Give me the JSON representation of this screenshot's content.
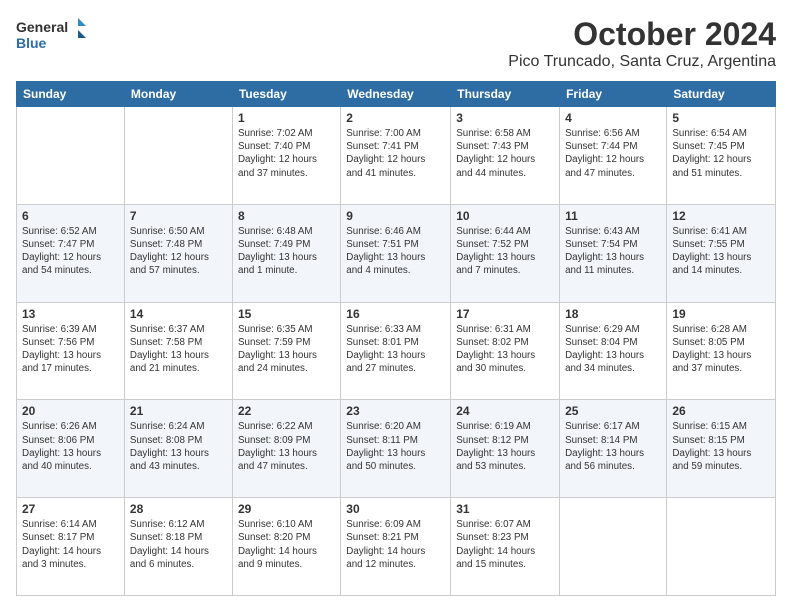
{
  "header": {
    "logo_line1": "General",
    "logo_line2": "Blue",
    "title": "October 2024",
    "subtitle": "Pico Truncado, Santa Cruz, Argentina"
  },
  "days_of_week": [
    "Sunday",
    "Monday",
    "Tuesday",
    "Wednesday",
    "Thursday",
    "Friday",
    "Saturday"
  ],
  "weeks": [
    [
      {
        "day": "",
        "info": ""
      },
      {
        "day": "",
        "info": ""
      },
      {
        "day": "1",
        "info": "Sunrise: 7:02 AM\nSunset: 7:40 PM\nDaylight: 12 hours\nand 37 minutes."
      },
      {
        "day": "2",
        "info": "Sunrise: 7:00 AM\nSunset: 7:41 PM\nDaylight: 12 hours\nand 41 minutes."
      },
      {
        "day": "3",
        "info": "Sunrise: 6:58 AM\nSunset: 7:43 PM\nDaylight: 12 hours\nand 44 minutes."
      },
      {
        "day": "4",
        "info": "Sunrise: 6:56 AM\nSunset: 7:44 PM\nDaylight: 12 hours\nand 47 minutes."
      },
      {
        "day": "5",
        "info": "Sunrise: 6:54 AM\nSunset: 7:45 PM\nDaylight: 12 hours\nand 51 minutes."
      }
    ],
    [
      {
        "day": "6",
        "info": "Sunrise: 6:52 AM\nSunset: 7:47 PM\nDaylight: 12 hours\nand 54 minutes."
      },
      {
        "day": "7",
        "info": "Sunrise: 6:50 AM\nSunset: 7:48 PM\nDaylight: 12 hours\nand 57 minutes."
      },
      {
        "day": "8",
        "info": "Sunrise: 6:48 AM\nSunset: 7:49 PM\nDaylight: 13 hours\nand 1 minute."
      },
      {
        "day": "9",
        "info": "Sunrise: 6:46 AM\nSunset: 7:51 PM\nDaylight: 13 hours\nand 4 minutes."
      },
      {
        "day": "10",
        "info": "Sunrise: 6:44 AM\nSunset: 7:52 PM\nDaylight: 13 hours\nand 7 minutes."
      },
      {
        "day": "11",
        "info": "Sunrise: 6:43 AM\nSunset: 7:54 PM\nDaylight: 13 hours\nand 11 minutes."
      },
      {
        "day": "12",
        "info": "Sunrise: 6:41 AM\nSunset: 7:55 PM\nDaylight: 13 hours\nand 14 minutes."
      }
    ],
    [
      {
        "day": "13",
        "info": "Sunrise: 6:39 AM\nSunset: 7:56 PM\nDaylight: 13 hours\nand 17 minutes."
      },
      {
        "day": "14",
        "info": "Sunrise: 6:37 AM\nSunset: 7:58 PM\nDaylight: 13 hours\nand 21 minutes."
      },
      {
        "day": "15",
        "info": "Sunrise: 6:35 AM\nSunset: 7:59 PM\nDaylight: 13 hours\nand 24 minutes."
      },
      {
        "day": "16",
        "info": "Sunrise: 6:33 AM\nSunset: 8:01 PM\nDaylight: 13 hours\nand 27 minutes."
      },
      {
        "day": "17",
        "info": "Sunrise: 6:31 AM\nSunset: 8:02 PM\nDaylight: 13 hours\nand 30 minutes."
      },
      {
        "day": "18",
        "info": "Sunrise: 6:29 AM\nSunset: 8:04 PM\nDaylight: 13 hours\nand 34 minutes."
      },
      {
        "day": "19",
        "info": "Sunrise: 6:28 AM\nSunset: 8:05 PM\nDaylight: 13 hours\nand 37 minutes."
      }
    ],
    [
      {
        "day": "20",
        "info": "Sunrise: 6:26 AM\nSunset: 8:06 PM\nDaylight: 13 hours\nand 40 minutes."
      },
      {
        "day": "21",
        "info": "Sunrise: 6:24 AM\nSunset: 8:08 PM\nDaylight: 13 hours\nand 43 minutes."
      },
      {
        "day": "22",
        "info": "Sunrise: 6:22 AM\nSunset: 8:09 PM\nDaylight: 13 hours\nand 47 minutes."
      },
      {
        "day": "23",
        "info": "Sunrise: 6:20 AM\nSunset: 8:11 PM\nDaylight: 13 hours\nand 50 minutes."
      },
      {
        "day": "24",
        "info": "Sunrise: 6:19 AM\nSunset: 8:12 PM\nDaylight: 13 hours\nand 53 minutes."
      },
      {
        "day": "25",
        "info": "Sunrise: 6:17 AM\nSunset: 8:14 PM\nDaylight: 13 hours\nand 56 minutes."
      },
      {
        "day": "26",
        "info": "Sunrise: 6:15 AM\nSunset: 8:15 PM\nDaylight: 13 hours\nand 59 minutes."
      }
    ],
    [
      {
        "day": "27",
        "info": "Sunrise: 6:14 AM\nSunset: 8:17 PM\nDaylight: 14 hours\nand 3 minutes."
      },
      {
        "day": "28",
        "info": "Sunrise: 6:12 AM\nSunset: 8:18 PM\nDaylight: 14 hours\nand 6 minutes."
      },
      {
        "day": "29",
        "info": "Sunrise: 6:10 AM\nSunset: 8:20 PM\nDaylight: 14 hours\nand 9 minutes."
      },
      {
        "day": "30",
        "info": "Sunrise: 6:09 AM\nSunset: 8:21 PM\nDaylight: 14 hours\nand 12 minutes."
      },
      {
        "day": "31",
        "info": "Sunrise: 6:07 AM\nSunset: 8:23 PM\nDaylight: 14 hours\nand 15 minutes."
      },
      {
        "day": "",
        "info": ""
      },
      {
        "day": "",
        "info": ""
      }
    ]
  ]
}
